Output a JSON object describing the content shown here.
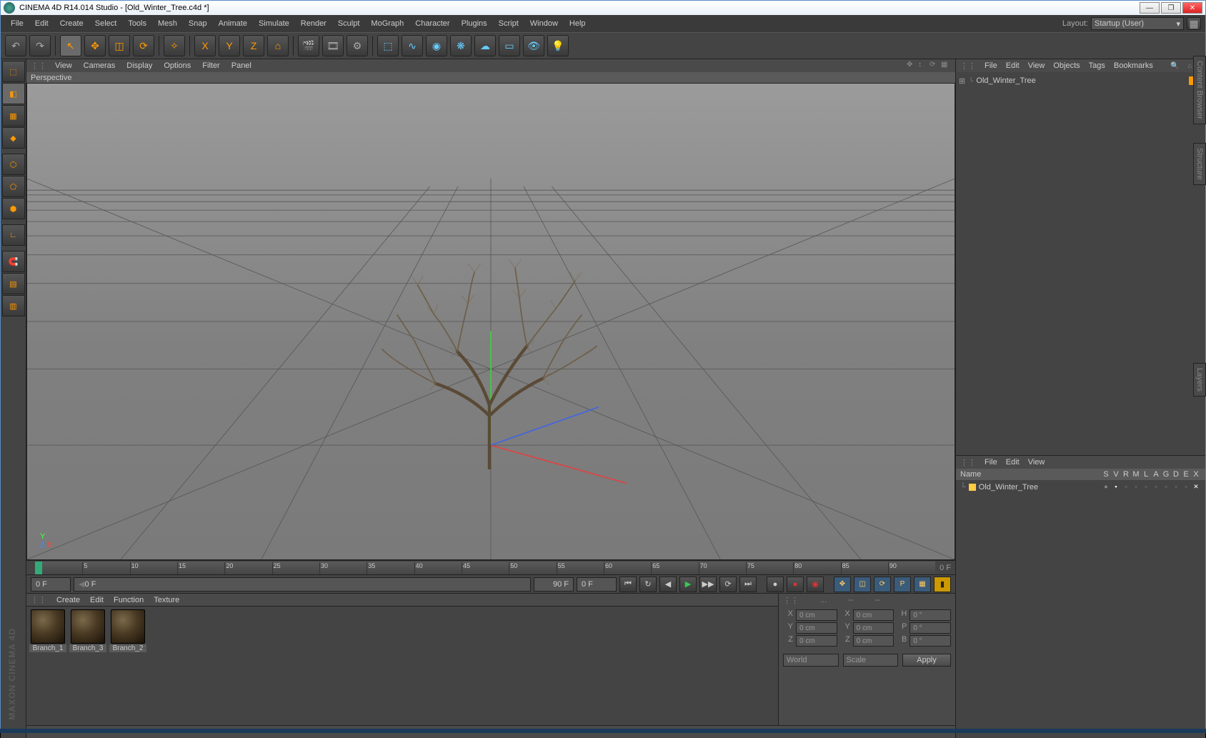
{
  "title": "CINEMA 4D R14.014 Studio - [Old_Winter_Tree.c4d *]",
  "menu": [
    "File",
    "Edit",
    "Create",
    "Select",
    "Tools",
    "Mesh",
    "Snap",
    "Animate",
    "Simulate",
    "Render",
    "Sculpt",
    "MoGraph",
    "Character",
    "Plugins",
    "Script",
    "Window",
    "Help"
  ],
  "layout_label": "Layout:",
  "layout_value": "Startup (User)",
  "viewport_menu": [
    "View",
    "Cameras",
    "Display",
    "Options",
    "Filter",
    "Panel"
  ],
  "viewport_name": "Perspective",
  "timeline": {
    "start": 0,
    "end": 90,
    "step": 5,
    "end_label": "0 F"
  },
  "timebar": {
    "cur": "0 F",
    "cur2": "0 F",
    "range_end": "90 F",
    "range_cur": "0 F"
  },
  "material_menu": [
    "Create",
    "Edit",
    "Function",
    "Texture"
  ],
  "materials": [
    {
      "name": "Branch_1"
    },
    {
      "name": "Branch_3"
    },
    {
      "name": "Branch_2"
    }
  ],
  "coord": {
    "header": [
      "...",
      "--",
      "--"
    ],
    "rows": [
      {
        "a": "X",
        "av": "0 cm",
        "b": "X",
        "bv": "0 cm",
        "c": "H",
        "cv": "0 °"
      },
      {
        "a": "Y",
        "av": "0 cm",
        "b": "Y",
        "bv": "0 cm",
        "c": "P",
        "cv": "0 °"
      },
      {
        "a": "Z",
        "av": "0 cm",
        "b": "Z",
        "bv": "0 cm",
        "c": "B",
        "cv": "0 °"
      }
    ],
    "dd1": "World",
    "dd2": "Scale",
    "apply": "Apply"
  },
  "obj_menu": [
    "File",
    "Edit",
    "View",
    "Objects",
    "Tags",
    "Bookmarks"
  ],
  "obj_tree": [
    {
      "name": "Old_Winter_Tree"
    }
  ],
  "layer_menu": [
    "File",
    "Edit",
    "View"
  ],
  "layer_cols": {
    "name": "Name",
    "flags": [
      "S",
      "V",
      "R",
      "M",
      "L",
      "A",
      "G",
      "D",
      "E",
      "X"
    ]
  },
  "layers": [
    {
      "name": "Old_Winter_Tree"
    }
  ],
  "side_tabs": [
    "Content Browser",
    "Structure",
    "Layers"
  ],
  "watermark": "MAXON CINEMA 4D",
  "axis": {
    "x": "X",
    "y": "Y",
    "z": "Z"
  }
}
